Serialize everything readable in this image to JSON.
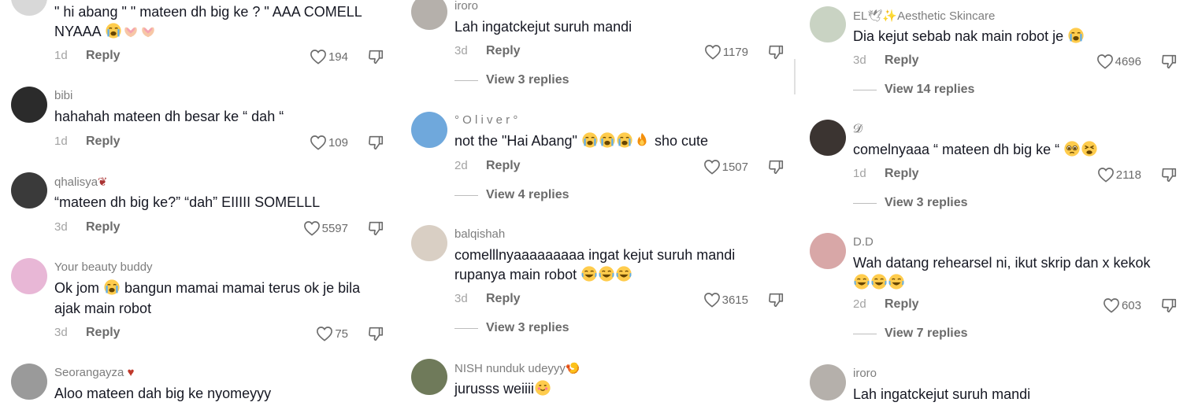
{
  "columns": [
    {
      "comments": [
        {
          "username": "",
          "lines": [
            "\" hi abang \" \" mateen dh big ke ? \" AAA COMELL",
            "NYAAA"
          ],
          "emoji_tail": [
            "loudly-crying-face-emoji",
            "heart-hands-emoji",
            "heart-hands-emoji"
          ],
          "date": "1d",
          "reply": "Reply",
          "likes": "194"
        },
        {
          "username": "bibi",
          "lines": [
            "hahahah mateen dh besar ke “ dah “"
          ],
          "date": "1d",
          "reply": "Reply",
          "likes": "109"
        },
        {
          "username": "qhalisya",
          "username_emoji": "wilted-flower-emoji",
          "lines": [
            "“mateen dh big ke?” “dah” EIIIII SOMELLL"
          ],
          "date": "3d",
          "reply": "Reply",
          "likes": "5597"
        },
        {
          "username": "Your beauty buddy",
          "lines": [
            "Ok jom",
            "bangun mamai mamai terus ok je bila",
            "ajak main robot"
          ],
          "date": "3d",
          "reply": "Reply",
          "likes": "75"
        },
        {
          "username": "Seorangayza",
          "username_emoji": "anatomical-heart-emoji",
          "lines": [
            "Aloo mateen dah big ke nyomeyyy"
          ]
        }
      ]
    },
    {
      "comments": [
        {
          "username": "iroro",
          "lines": [
            "Lah ingatckejut suruh mandi"
          ],
          "date": "3d",
          "reply": "Reply",
          "likes": "1179",
          "view_replies": "View 3 replies"
        },
        {
          "username": "° O l i v e r °",
          "lines": [
            "not the \"Hai Abang\"",
            "sho cute"
          ],
          "date": "2d",
          "reply": "Reply",
          "likes": "1507",
          "view_replies": "View 4 replies"
        },
        {
          "username": "balqishah",
          "lines": [
            "comelllnyaaaaaaaaa ingat kejut suruh mandi",
            "rupanya main robot"
          ],
          "date": "3d",
          "reply": "Reply",
          "likes": "3615",
          "view_replies": "View 3 replies"
        },
        {
          "username": "NISH nunduk udeyyy",
          "username_emoji": "shrimp-emoji",
          "lines": [
            "jurusss weiiii"
          ]
        }
      ]
    },
    {
      "comments": [
        {
          "username": "EL",
          "username_suffix": "Aesthetic Skincare",
          "lines": [
            "Dia kejut sebab nak main robot je"
          ],
          "date": "3d",
          "reply": "Reply",
          "likes": "4696",
          "view_replies": "View 14 replies"
        },
        {
          "username": "𝓓",
          "lines": [
            "comelnyaaa “ mateen dh big ke “"
          ],
          "date": "1d",
          "reply": "Reply",
          "likes": "2118",
          "view_replies": "View 3 replies"
        },
        {
          "username": "D.D",
          "lines": [
            "Wah datang rehearsel ni, ikut skrip dan x kekok"
          ],
          "date": "2d",
          "reply": "Reply",
          "likes": "603",
          "view_replies": "View 7 replies"
        },
        {
          "username": "iroro",
          "lines": [
            "Lah ingatckejut suruh mandi"
          ]
        }
      ]
    }
  ],
  "colors": {
    "text": "#161823",
    "meta": "#a3a3a3",
    "username": "#7d7d7d",
    "action": "#6b6b6b"
  }
}
